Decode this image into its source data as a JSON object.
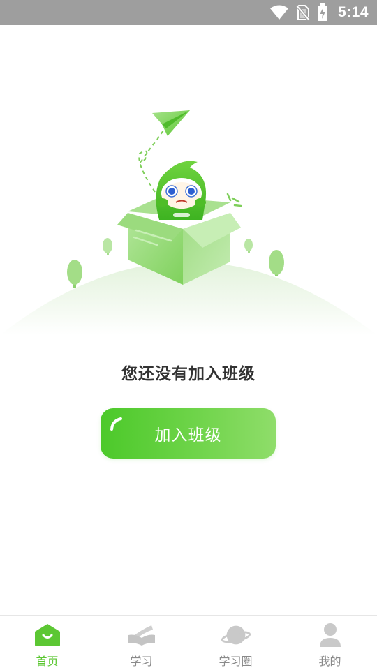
{
  "status_bar": {
    "time": "5:14",
    "icons": [
      "wifi-icon",
      "no-sim-icon",
      "battery-charging-icon"
    ]
  },
  "empty_state": {
    "title": "您还没有加入班级",
    "illustration": "mascot-in-box-with-paper-plane"
  },
  "actions": {
    "join_class_label": "加入班级"
  },
  "bottom_nav": {
    "items": [
      {
        "label": "首页",
        "icon": "home-icon",
        "active": true
      },
      {
        "label": "学习",
        "icon": "study-icon",
        "active": false
      },
      {
        "label": "学习圈",
        "icon": "planet-icon",
        "active": false
      },
      {
        "label": "我的",
        "icon": "profile-icon",
        "active": false
      }
    ]
  },
  "colors": {
    "accent": "#5cc733",
    "status_bar": "#9e9e9e",
    "inactive": "#8a8a8a",
    "title_text": "#333333"
  }
}
